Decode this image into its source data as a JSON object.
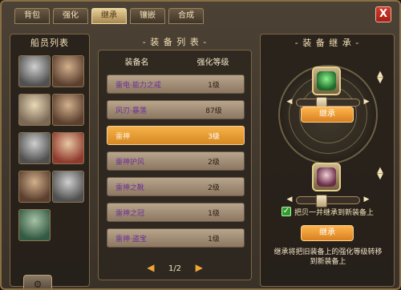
{
  "tabs": [
    {
      "label": "背包"
    },
    {
      "label": "强化"
    },
    {
      "label": "继承",
      "active": true
    },
    {
      "label": "镶嵌"
    },
    {
      "label": "合成"
    }
  ],
  "close": {
    "label": "X"
  },
  "crew": {
    "title": "船员列表"
  },
  "equipment": {
    "title": "- 装 备 列 表 -",
    "columns": [
      "装备名",
      "强化等级"
    ],
    "rows": [
      {
        "name": "雷电·能力之戒",
        "level": "1级"
      },
      {
        "name": "风刃·暴落",
        "level": "87级"
      },
      {
        "name": "雷神",
        "level": "3级",
        "selected": true
      },
      {
        "name": "雷神护风",
        "level": "2级"
      },
      {
        "name": "雷神之靴",
        "level": "2级"
      },
      {
        "name": "雷神之冠",
        "level": "1级"
      },
      {
        "name": "雷神·盗宝",
        "level": "1级"
      }
    ],
    "pager": {
      "text": "1/2"
    }
  },
  "inherit": {
    "title": "- 装 备 继 承 -",
    "top_button": "继承",
    "bottom_button": "继承",
    "checkbox_label": "把贝一并继承到新装备上",
    "description": "继承将把旧装备上的强化等级转移到新装备上"
  }
}
